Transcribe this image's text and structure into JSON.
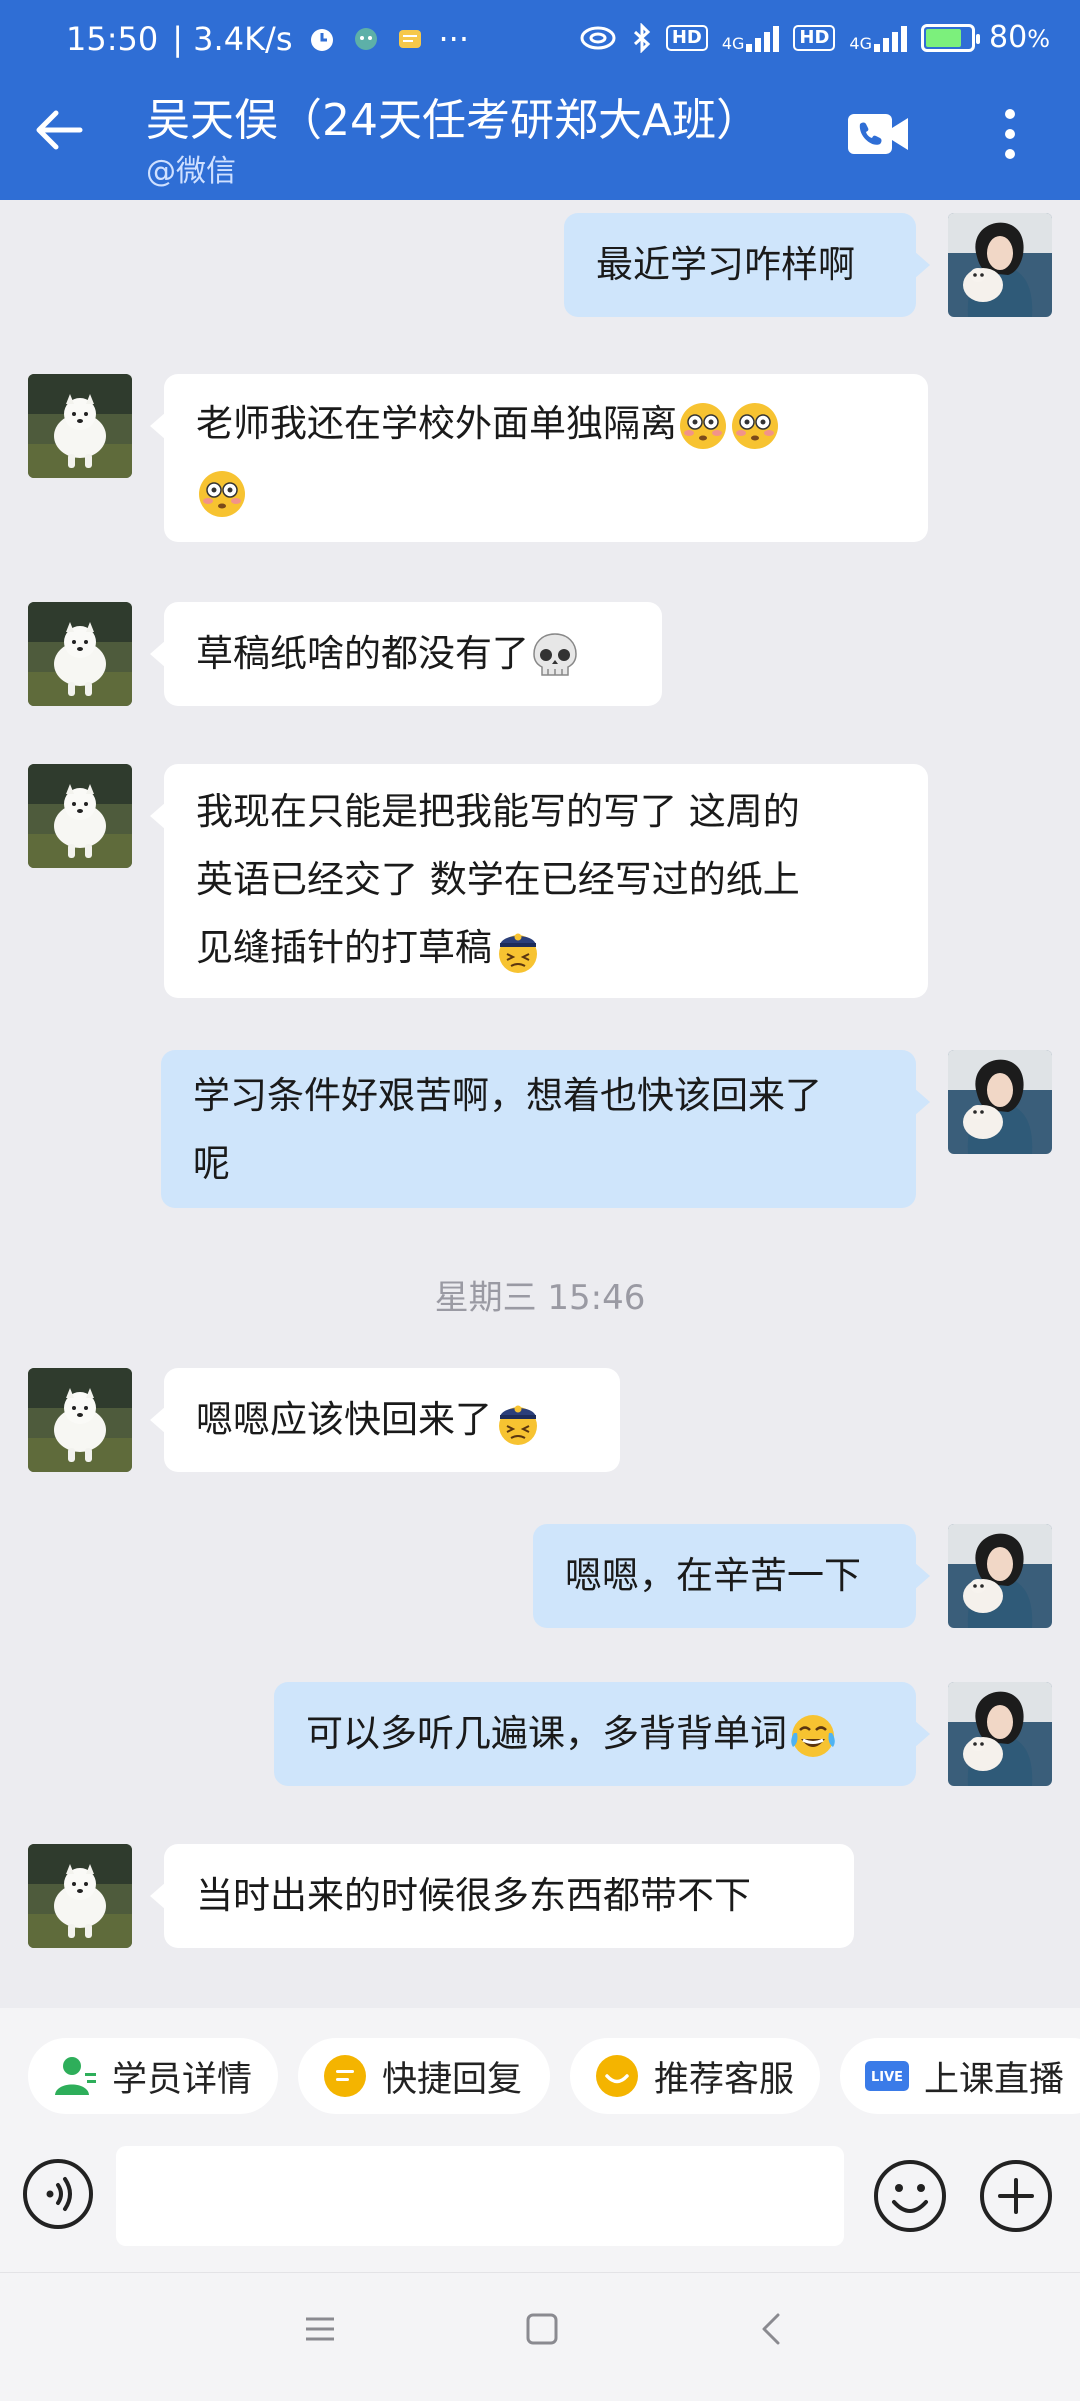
{
  "status_bar": {
    "time": "15:50",
    "speed": "| 3.4K/s",
    "dots": "···",
    "hd1": "HD",
    "net1": "4G",
    "hd2": "HD",
    "net2": "4G",
    "battery": "80",
    "battery_unit": "%",
    "battery_level": 0.8
  },
  "header": {
    "title": "吴天俣（24天任考研郑大A班）",
    "subtitle": "@微信"
  },
  "messages": [
    {
      "side": "right",
      "text": "最近学习咋样啊"
    },
    {
      "side": "left",
      "line1": "老师我还在学校外面单独隔离",
      "emoji": "flushed-face-emoji"
    },
    {
      "side": "left",
      "text": "草稿纸啥的都没有了",
      "emoji": "skull-emoji"
    },
    {
      "side": "left",
      "line1": "我现在只能是把我能写的写了 这周的",
      "line2": "英语已经交了 数学在已经写过的纸上",
      "line3": "见缝插针的打草稿",
      "emoji": "police-face-emoji"
    },
    {
      "side": "right",
      "line1": "学习条件好艰苦啊，想着也快该回来了",
      "line2": "呢"
    },
    {
      "side": "left",
      "text": "嗯嗯应该快回来了",
      "emoji": "police-face-emoji"
    },
    {
      "side": "right",
      "text": "嗯嗯，在辛苦一下"
    },
    {
      "side": "right",
      "text": "可以多听几遍课，多背背单词",
      "emoji": "tears-of-joy-emoji"
    },
    {
      "side": "left",
      "text": "当时出来的时候很多东西都带不下"
    }
  ],
  "timestamp": "星期三  15:46",
  "quick_actions": [
    {
      "label": "学员详情",
      "icon": "student-profile-icon",
      "color": "#2eae5a"
    },
    {
      "label": "快捷回复",
      "icon": "quick-reply-icon",
      "color": "#f4b400"
    },
    {
      "label": "推荐客服",
      "icon": "recommend-service-icon",
      "color": "#f4b400"
    },
    {
      "label": "上课直播",
      "icon": "live-icon",
      "color": "#3a7be8",
      "badge": "LIVE"
    }
  ],
  "input": {
    "placeholder": ""
  },
  "colors": {
    "header": "#2f6ed5",
    "bubble_self": "#cfe5fb",
    "bubble_other": "#ffffff",
    "background": "#ececf0"
  }
}
